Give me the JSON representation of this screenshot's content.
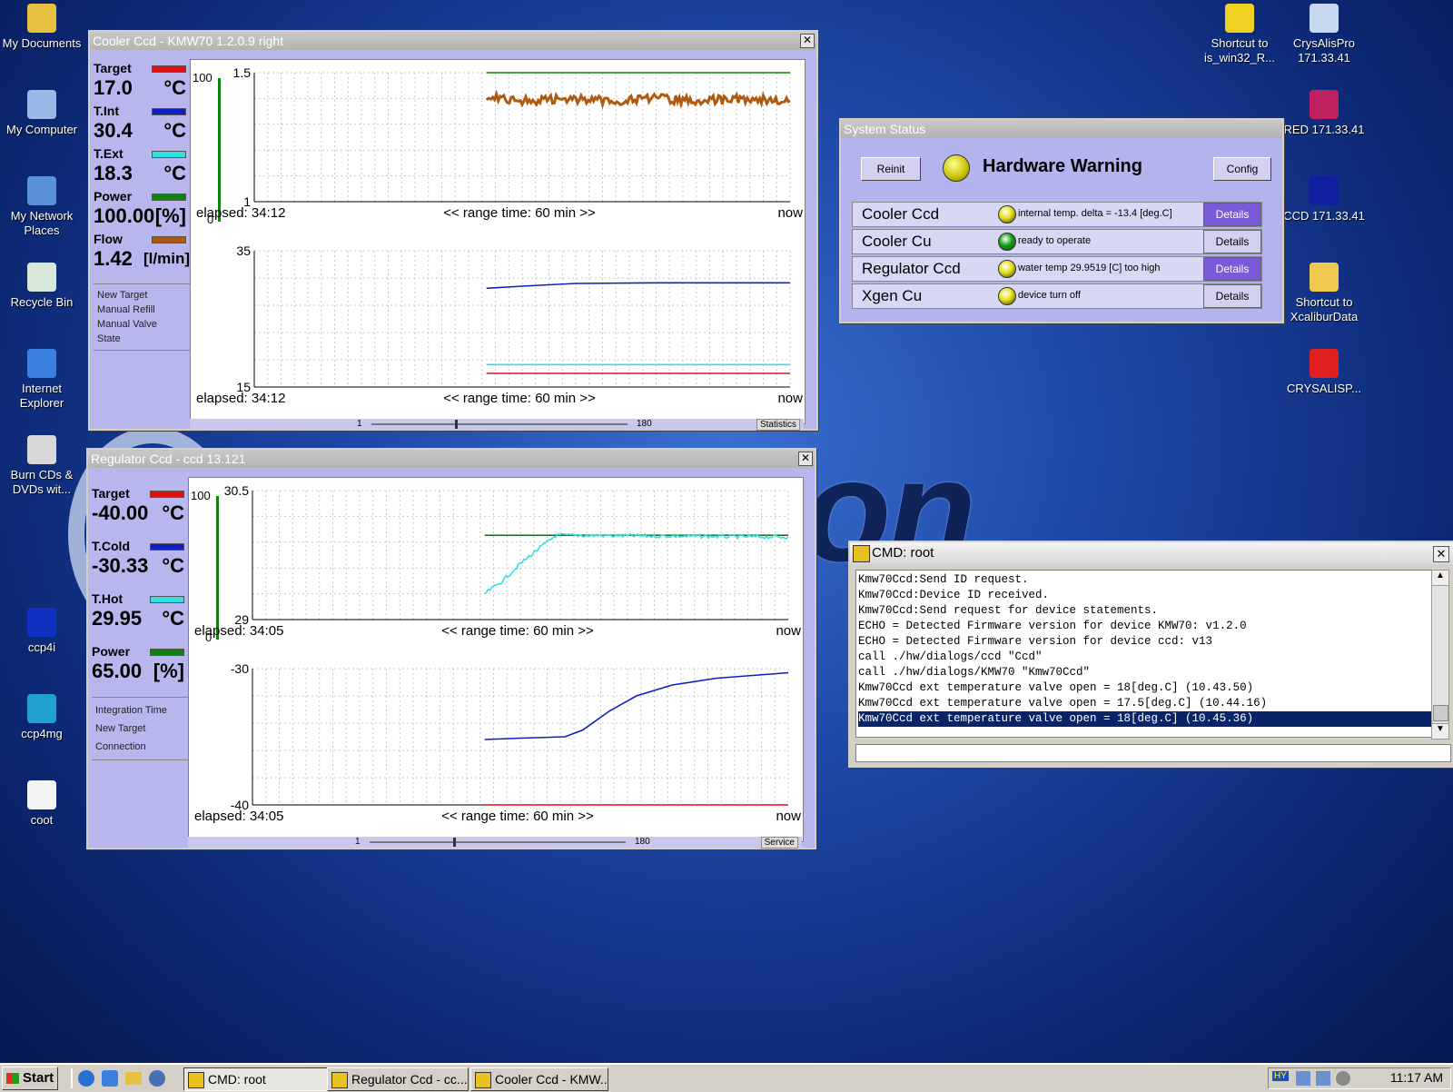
{
  "desktop": {
    "left_icons": [
      {
        "label": "My Documents",
        "icon": "folder-docs-icon"
      },
      {
        "label": "My Computer",
        "icon": "computer-icon"
      },
      {
        "label": "My Network Places",
        "icon": "network-icon"
      },
      {
        "label": "Recycle Bin",
        "icon": "recycle-bin-icon"
      },
      {
        "label": "Internet Explorer",
        "icon": "ie-icon"
      },
      {
        "label": "Burn CDs & DVDs wit...",
        "icon": "cd-icon"
      },
      {
        "label": "ccp4i",
        "icon": "ccp4i-icon"
      },
      {
        "label": "ccp4mg",
        "icon": "ccp4mg-icon"
      },
      {
        "label": "coot",
        "icon": "coot-icon"
      }
    ],
    "right_icons": [
      {
        "label": "Shortcut to is_win32_R...",
        "icon": "shortcut-icon"
      },
      {
        "label": "CrysAlisPro 171.33.41",
        "icon": "crysalispro-icon"
      },
      {
        "label": "RED 171.33.41",
        "icon": "red-icon"
      },
      {
        "label": "CCD 171.33.41",
        "icon": "ccd-icon"
      },
      {
        "label": "Shortcut to XcaliburData",
        "icon": "folder-icon"
      },
      {
        "label": "CRYSALISP...",
        "icon": "crysalisp-icon"
      }
    ],
    "wallpaper_text": "ffraction"
  },
  "cooler_window": {
    "title": "Cooler Ccd - KMW70 1.2.0.9 right",
    "readouts": [
      {
        "label": "Target",
        "value": "17.0",
        "unit": "°C",
        "color": "#e01010"
      },
      {
        "label": "T.Int",
        "value": "30.4",
        "unit": "°C",
        "color": "#1020c0"
      },
      {
        "label": "T.Ext",
        "value": "18.3",
        "unit": "°C",
        "color": "#30e0e0"
      },
      {
        "label": "Power",
        "value": "100.00",
        "unit": "[%]",
        "color": "#108010"
      },
      {
        "label": "Flow",
        "value": "1.42",
        "unit": "[l/min]",
        "color": "#b05a10"
      }
    ],
    "menu": [
      "New Target",
      "Manual Refill",
      "Manual Valve",
      "State"
    ],
    "gauge_max": "100",
    "gauge_min": "0",
    "gauge_level": 1.0,
    "slider": {
      "min": "1",
      "max": "180",
      "button": "Statistics"
    }
  },
  "regulator_window": {
    "title": "Regulator Ccd - ccd 13.121",
    "readouts": [
      {
        "label": "Target",
        "value": "-40.00",
        "unit": "°C",
        "color": "#e01010"
      },
      {
        "label": "T.Cold",
        "value": "-30.33",
        "unit": "°C",
        "color": "#1020c0"
      },
      {
        "label": "T.Hot",
        "value": "29.95",
        "unit": "°C",
        "color": "#30e0e0"
      },
      {
        "label": "Power",
        "value": "65.00",
        "unit": "[%]",
        "color": "#108010"
      }
    ],
    "menu": [
      "Integration Time",
      "New Target",
      "Connection"
    ],
    "gauge_max": "100",
    "gauge_min": "0",
    "gauge_level": 1.0,
    "slider": {
      "min": "1",
      "max": "180",
      "button": "Service"
    }
  },
  "status_window": {
    "title": "System Status",
    "reinit": "Reinit",
    "headline": "Hardware Warning",
    "config": "Config",
    "rows": [
      {
        "name": "Cooler Ccd",
        "msg": "internal temp. delta = -13.4 [deg.C]",
        "led": "#e6e010",
        "details": "Details",
        "highlight": true
      },
      {
        "name": "Cooler Cu",
        "msg": "ready to operate",
        "led": "#10a010",
        "details": "Details",
        "highlight": false
      },
      {
        "name": "Regulator Ccd",
        "msg": "water temp 29.9519 [C] too high",
        "led": "#e6e010",
        "details": "Details",
        "highlight": true
      },
      {
        "name": "Xgen Cu",
        "msg": "device turn off",
        "led": "#e6e010",
        "details": "Details",
        "highlight": false
      }
    ]
  },
  "cmd_window": {
    "title": "CMD: root",
    "lines": [
      "Kmw70Ccd:Send ID request.",
      "Kmw70Ccd:Device ID received.",
      "Kmw70Ccd:Send request for device statements.",
      "ECHO = Detected Firmware version for device KMW70: v1.2.0",
      "ECHO = Detected Firmware version for device ccd: v13",
      "call ./hw/dialogs/ccd \"Ccd\"",
      "call ./hw/dialogs/KMW70 \"Kmw70Ccd\"",
      "Kmw70Ccd ext temperature valve open = 18[deg.C] (10.43.50)",
      "Kmw70Ccd ext temperature valve open = 17.5[deg.C] (10.44.16)",
      "Kmw70Ccd ext temperature valve open = 18[deg.C] (10.45.36)"
    ],
    "input_value": ""
  },
  "taskbar": {
    "start": "Start",
    "tasks": [
      "CMD: root",
      "Regulator Ccd - cc...",
      "Cooler Ccd - KMW..."
    ],
    "clock": "11:17 AM",
    "lang": "HY"
  },
  "chart_data": [
    {
      "id": "cooler_top",
      "type": "line",
      "footer": {
        "elapsed": "elapsed: 34:12",
        "range": "<< range time: 60 min >>",
        "end": "now"
      },
      "ylim": [
        1,
        1.5
      ],
      "yticks": [
        "1.5",
        "1"
      ],
      "xlim": [
        0,
        60
      ],
      "series": [
        {
          "color": "#108010",
          "points": [
            [
              26,
              1.5
            ],
            [
              60,
              1.5
            ]
          ],
          "noisy": false
        },
        {
          "color": "#b05a10",
          "points": [
            [
              26,
              1.41
            ],
            [
              26.5,
              1.41
            ],
            [
              30,
              1.39
            ],
            [
              35,
              1.4
            ],
            [
              40,
              1.39
            ],
            [
              45,
              1.4
            ],
            [
              50,
              1.39
            ],
            [
              55,
              1.4
            ],
            [
              60,
              1.39
            ]
          ],
          "noisy": true
        }
      ]
    },
    {
      "id": "cooler_bottom",
      "type": "line",
      "footer": {
        "elapsed": "elapsed: 34:12",
        "range": "<< range time: 60 min >>",
        "end": "now"
      },
      "ylim": [
        15,
        35
      ],
      "yticks": [
        "35",
        "15"
      ],
      "xlim": [
        0,
        60
      ],
      "series": [
        {
          "color": "#1020c0",
          "points": [
            [
              26,
              29.5
            ],
            [
              30,
              29.8
            ],
            [
              36,
              30.2
            ],
            [
              45,
              30.3
            ],
            [
              60,
              30.3
            ]
          ],
          "noisy": false
        },
        {
          "color": "#30e0e0",
          "points": [
            [
              26,
              18.3
            ],
            [
              60,
              18.3
            ]
          ],
          "noisy": false
        },
        {
          "color": "#e01010",
          "points": [
            [
              26,
              17.0
            ],
            [
              60,
              17.0
            ]
          ],
          "noisy": false
        }
      ]
    },
    {
      "id": "regulator_top",
      "type": "line",
      "footer": {
        "elapsed": "elapsed: 34:05",
        "range": "<< range time: 60 min >>",
        "end": "now"
      },
      "ylim": [
        29,
        30.5
      ],
      "yticks": [
        "30.5",
        "29"
      ],
      "xlim": [
        0,
        60
      ],
      "series": [
        {
          "color": "#108010",
          "points": [
            [
              26,
              29.98
            ],
            [
              60,
              29.98
            ]
          ],
          "noisy": false
        },
        {
          "color": "#30e0e0",
          "points": [
            [
              26,
              29.3
            ],
            [
              28,
              29.45
            ],
            [
              30,
              29.65
            ],
            [
              32,
              29.82
            ],
            [
              34,
              29.98
            ],
            [
              60,
              29.96
            ]
          ],
          "noisy": true
        }
      ]
    },
    {
      "id": "regulator_bottom",
      "type": "line",
      "footer": {
        "elapsed": "elapsed: 34:05",
        "range": "<< range time: 60 min >>",
        "end": "now"
      },
      "ylim": [
        -40,
        -30
      ],
      "yticks": [
        "-30",
        "-40"
      ],
      "xlim": [
        0,
        60
      ],
      "series": [
        {
          "color": "#e01010",
          "points": [
            [
              26,
              -40
            ],
            [
              60,
              -40
            ]
          ],
          "noisy": false
        },
        {
          "color": "#1020c0",
          "points": [
            [
              26,
              -35.2
            ],
            [
              30,
              -35.1
            ],
            [
              35,
              -35
            ],
            [
              37,
              -34.5
            ],
            [
              40,
              -33.1
            ],
            [
              43,
              -32
            ],
            [
              47,
              -31.2
            ],
            [
              52,
              -30.7
            ],
            [
              56,
              -30.5
            ],
            [
              60,
              -30.3
            ]
          ],
          "noisy": false
        }
      ]
    }
  ]
}
